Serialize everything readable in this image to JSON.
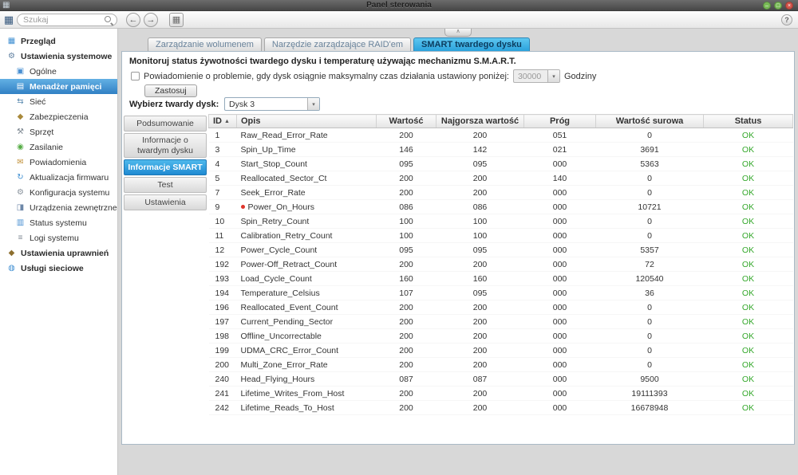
{
  "window": {
    "title": "Panel sterowania",
    "app_glyph": "▦",
    "collapse_glyph": "∧",
    "controls": [
      {
        "name": "minimize",
        "glyph": "–",
        "color": "#79ba57"
      },
      {
        "name": "maximize",
        "glyph": "□",
        "color": "#79ba57"
      },
      {
        "name": "close",
        "glyph": "×",
        "color": "#d15248"
      }
    ]
  },
  "toolbar": {
    "search_placeholder": "Szukaj",
    "menu_glyph": "▦",
    "back_glyph": "←",
    "forward_glyph": "→",
    "apps_glyph": "▦",
    "help_glyph": "?"
  },
  "sidebar": {
    "items": [
      {
        "id": "overview",
        "label": "Przegląd",
        "glyph": "▦",
        "color": "#3f8fd2",
        "level": 0,
        "selected": false
      },
      {
        "id": "system-settings",
        "label": "Ustawienia systemowe",
        "glyph": "⚙",
        "color": "#5e7fa0",
        "level": 0,
        "selected": false
      },
      {
        "id": "general",
        "label": "Ogólne",
        "glyph": "▣",
        "color": "#4a90d2",
        "level": 1,
        "selected": false
      },
      {
        "id": "storage-manager",
        "label": "Menadżer pamięci",
        "glyph": "▤",
        "color": "#ffffff",
        "level": 1,
        "selected": true
      },
      {
        "id": "network",
        "label": "Sieć",
        "glyph": "⇆",
        "color": "#5b8ab0",
        "level": 1,
        "selected": false
      },
      {
        "id": "security",
        "label": "Zabezpieczenia",
        "glyph": "◆",
        "color": "#a98a3c",
        "level": 1,
        "selected": false
      },
      {
        "id": "hardware",
        "label": "Sprzęt",
        "glyph": "⚒",
        "color": "#7d8791",
        "level": 1,
        "selected": false
      },
      {
        "id": "power",
        "label": "Zasilanie",
        "glyph": "◉",
        "color": "#56ad46",
        "level": 1,
        "selected": false
      },
      {
        "id": "notifications",
        "label": "Powiadomienia",
        "glyph": "✉",
        "color": "#c2913a",
        "level": 1,
        "selected": false
      },
      {
        "id": "firmware-update",
        "label": "Aktualizacja firmwaru",
        "glyph": "↻",
        "color": "#3f8fd2",
        "level": 1,
        "selected": false
      },
      {
        "id": "system-configuration",
        "label": "Konfiguracja systemu",
        "glyph": "⚙",
        "color": "#88929c",
        "level": 1,
        "selected": false
      },
      {
        "id": "external-devices",
        "label": "Urządzenia zewnętrzne",
        "glyph": "◨",
        "color": "#6d87a8",
        "level": 1,
        "selected": false
      },
      {
        "id": "system-status",
        "label": "Status systemu",
        "glyph": "▥",
        "color": "#4a90d2",
        "level": 1,
        "selected": false
      },
      {
        "id": "system-logs",
        "label": "Logi systemu",
        "glyph": "≡",
        "color": "#7d8791",
        "level": 1,
        "selected": false
      },
      {
        "id": "privilege-settings",
        "label": "Ustawienia uprawnień",
        "glyph": "◆",
        "color": "#8d6f2f",
        "level": 0,
        "selected": false
      },
      {
        "id": "network-services",
        "label": "Usługi sieciowe",
        "glyph": "◍",
        "color": "#3f8fd2",
        "level": 0,
        "selected": false
      }
    ]
  },
  "tabs": [
    {
      "id": "volume-management",
      "label": "Zarządzanie wolumenem",
      "active": false
    },
    {
      "id": "raid-management-tool",
      "label": "Narzędzie zarządzające RAID'em",
      "active": false
    },
    {
      "id": "hdd-smart",
      "label": "SMART twardego dysku",
      "active": true
    }
  ],
  "smart_panel": {
    "intro": "Monitoruj status żywotności twardego dysku i temperaturę używając mechanizmu S.M.A.R.T.",
    "notify_label": "Powiadomienie o problemie, gdy dysk osiągnie maksymalny czas działania ustawiony poniżej:",
    "notify_checked": false,
    "hours_value": "30000",
    "hours_unit": "Godziny",
    "dropdown_arrow": "▾",
    "apply_label": "Zastosuj",
    "disk_label": "Wybierz twardy dysk:",
    "disk_value": "Dysk 3",
    "subnav": [
      {
        "id": "summary",
        "label": "Podsumowanie",
        "active": false
      },
      {
        "id": "hdd-info",
        "label": "Informacje o twardym dysku",
        "active": false
      },
      {
        "id": "smart-info",
        "label": "Informacje SMART",
        "active": true
      },
      {
        "id": "test",
        "label": "Test",
        "active": false
      },
      {
        "id": "settings",
        "label": "Ustawienia",
        "active": false
      }
    ]
  },
  "smart_table": {
    "headers": [
      "ID",
      "Opis",
      "Wartość",
      "Najgorsza wartość",
      "Próg",
      "Wartość surowa",
      "Status"
    ],
    "sort_glyph": "▲",
    "status_ok_color": "#35a82c",
    "rows": [
      {
        "id": "1",
        "desc": "Raw_Read_Error_Rate",
        "value": "200",
        "worst": "200",
        "threshold": "051",
        "raw": "0",
        "status": "OK",
        "flagged": false
      },
      {
        "id": "3",
        "desc": "Spin_Up_Time",
        "value": "146",
        "worst": "142",
        "threshold": "021",
        "raw": "3691",
        "status": "OK",
        "flagged": false
      },
      {
        "id": "4",
        "desc": "Start_Stop_Count",
        "value": "095",
        "worst": "095",
        "threshold": "000",
        "raw": "5363",
        "status": "OK",
        "flagged": false
      },
      {
        "id": "5",
        "desc": "Reallocated_Sector_Ct",
        "value": "200",
        "worst": "200",
        "threshold": "140",
        "raw": "0",
        "status": "OK",
        "flagged": false
      },
      {
        "id": "7",
        "desc": "Seek_Error_Rate",
        "value": "200",
        "worst": "200",
        "threshold": "000",
        "raw": "0",
        "status": "OK",
        "flagged": false
      },
      {
        "id": "9",
        "desc": "Power_On_Hours",
        "value": "086",
        "worst": "086",
        "threshold": "000",
        "raw": "10721",
        "status": "OK",
        "flagged": true
      },
      {
        "id": "10",
        "desc": "Spin_Retry_Count",
        "value": "100",
        "worst": "100",
        "threshold": "000",
        "raw": "0",
        "status": "OK",
        "flagged": false
      },
      {
        "id": "11",
        "desc": "Calibration_Retry_Count",
        "value": "100",
        "worst": "100",
        "threshold": "000",
        "raw": "0",
        "status": "OK",
        "flagged": false
      },
      {
        "id": "12",
        "desc": "Power_Cycle_Count",
        "value": "095",
        "worst": "095",
        "threshold": "000",
        "raw": "5357",
        "status": "OK",
        "flagged": false
      },
      {
        "id": "192",
        "desc": "Power-Off_Retract_Count",
        "value": "200",
        "worst": "200",
        "threshold": "000",
        "raw": "72",
        "status": "OK",
        "flagged": false
      },
      {
        "id": "193",
        "desc": "Load_Cycle_Count",
        "value": "160",
        "worst": "160",
        "threshold": "000",
        "raw": "120540",
        "status": "OK",
        "flagged": false
      },
      {
        "id": "194",
        "desc": "Temperature_Celsius",
        "value": "107",
        "worst": "095",
        "threshold": "000",
        "raw": "36",
        "status": "OK",
        "flagged": false
      },
      {
        "id": "196",
        "desc": "Reallocated_Event_Count",
        "value": "200",
        "worst": "200",
        "threshold": "000",
        "raw": "0",
        "status": "OK",
        "flagged": false
      },
      {
        "id": "197",
        "desc": "Current_Pending_Sector",
        "value": "200",
        "worst": "200",
        "threshold": "000",
        "raw": "0",
        "status": "OK",
        "flagged": false
      },
      {
        "id": "198",
        "desc": "Offline_Uncorrectable",
        "value": "200",
        "worst": "200",
        "threshold": "000",
        "raw": "0",
        "status": "OK",
        "flagged": false
      },
      {
        "id": "199",
        "desc": "UDMA_CRC_Error_Count",
        "value": "200",
        "worst": "200",
        "threshold": "000",
        "raw": "0",
        "status": "OK",
        "flagged": false
      },
      {
        "id": "200",
        "desc": "Multi_Zone_Error_Rate",
        "value": "200",
        "worst": "200",
        "threshold": "000",
        "raw": "0",
        "status": "OK",
        "flagged": false
      },
      {
        "id": "240",
        "desc": "Head_Flying_Hours",
        "value": "087",
        "worst": "087",
        "threshold": "000",
        "raw": "9500",
        "status": "OK",
        "flagged": false
      },
      {
        "id": "241",
        "desc": "Lifetime_Writes_From_Host",
        "value": "200",
        "worst": "200",
        "threshold": "000",
        "raw": "19111393",
        "status": "OK",
        "flagged": false
      },
      {
        "id": "242",
        "desc": "Lifetime_Reads_To_Host",
        "value": "200",
        "worst": "200",
        "threshold": "000",
        "raw": "16678948",
        "status": "OK",
        "flagged": false
      }
    ]
  }
}
